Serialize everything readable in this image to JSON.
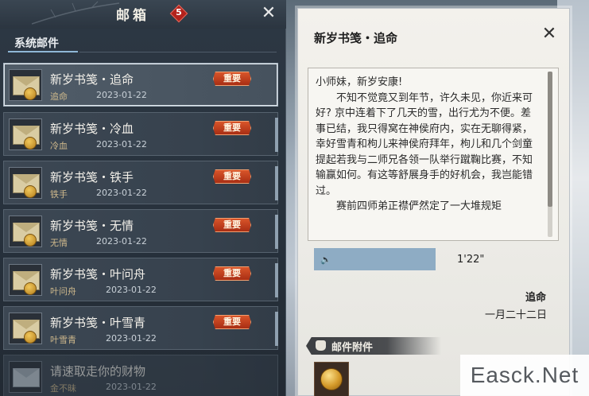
{
  "window": {
    "title": "邮箱",
    "unread_badge": "5",
    "close_glyph": "✕"
  },
  "sidebar": {
    "section_tab": "系统邮件",
    "important_label": "重要",
    "mails": [
      {
        "title": "新岁书笺・追命",
        "sender": "追命",
        "date": "2023-01-22",
        "important": true,
        "selected": true
      },
      {
        "title": "新岁书笺・冷血",
        "sender": "冷血",
        "date": "2023-01-22",
        "important": true,
        "selected": false
      },
      {
        "title": "新岁书笺・铁手",
        "sender": "铁手",
        "date": "2023-01-22",
        "important": true,
        "selected": false
      },
      {
        "title": "新岁书笺・无情",
        "sender": "无情",
        "date": "2023-01-22",
        "important": true,
        "selected": false
      },
      {
        "title": "新岁书笺・叶问舟",
        "sender": "叶问舟",
        "date": "2023-01-22",
        "important": true,
        "selected": false
      },
      {
        "title": "新岁书笺・叶雪青",
        "sender": "叶雪青",
        "date": "2023-01-22",
        "important": true,
        "selected": false
      },
      {
        "title": "请速取走你的财物",
        "sender": "金不昧",
        "date": "2023-01-22",
        "important": false,
        "selected": false
      }
    ]
  },
  "letter": {
    "title": "新岁书笺・追命",
    "greeting": "小师妹，新岁安康!",
    "para1": "不知不觉竟又到年节，许久未见，你近来可好? 京中连着下了几天的雪，出行尤为不便。差事已结，我只得窝在神侯府内，实在无聊得紧，幸好雪青和枸儿来神侯府拜年，枸儿和几个剑童提起若我与二师兄各领一队举行蹴鞠比赛，不知输赢如何。有这等舒展身手的好机会，我岂能错过。",
    "para2": "赛前四师弟正襟俨然定了一大堆规矩",
    "audio_duration": "1'22\"",
    "signature": "追命",
    "sign_date": "一月二十二日",
    "attachments_label": "邮件附件"
  },
  "watermark": "Easck.Net",
  "icons": {
    "envelope": "envelope-icon",
    "seal": "seal-icon",
    "speaker": "speaker-icon",
    "bag": "bag-icon",
    "coin": "coin-icon"
  },
  "colors": {
    "important_badge": "#c23e1c",
    "unread_badge": "#b3221c",
    "audio_bar": "#8eacc4",
    "selected_border": "#a9b6c2"
  }
}
